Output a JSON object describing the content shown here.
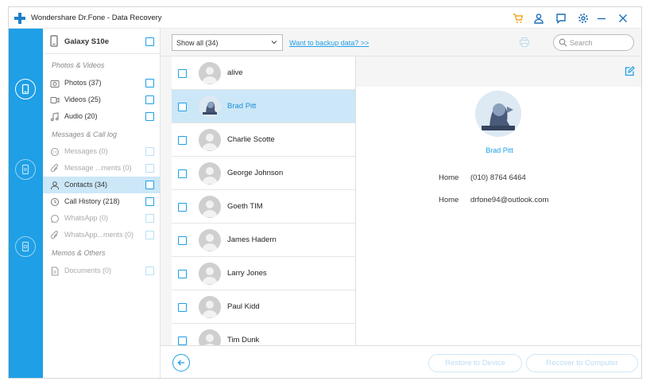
{
  "window": {
    "title": "Wondershare Dr.Fone - Data Recovery"
  },
  "titlebar_icons": [
    "cart-icon",
    "user-icon",
    "feedback-icon",
    "settings-icon",
    "minimize-icon",
    "close-icon"
  ],
  "colors": {
    "accent": "#1e9fe6",
    "cart": "#f5a623",
    "selected_row": "#cce7f7"
  },
  "device": {
    "name": "Galaxy S10e"
  },
  "categories": {
    "group1": "Photos & Videos",
    "photos": "Photos (37)",
    "videos": "Videos (25)",
    "audio": "Audio (20)",
    "group2": "Messages & Call log",
    "messages": "Messages (0)",
    "message_attachments": "Message ...ments (0)",
    "contacts": "Contacts (34)",
    "call_history": "Call History (218)",
    "whatsapp": "WhatsApp (0)",
    "whatsapp_attachments": "WhatsApp...ments (0)",
    "group3": "Memos & Others",
    "documents": "Documents (0)"
  },
  "toolbar": {
    "filter_value": "Show all (34)",
    "backup_link": "Want to backup data? >>",
    "search_placeholder": "Search"
  },
  "contacts": [
    {
      "name": "alive"
    },
    {
      "name": "Brad Pitt"
    },
    {
      "name": "Charlie Scotte"
    },
    {
      "name": "George Johnson"
    },
    {
      "name": "Goeth TIM"
    },
    {
      "name": "James Hadern"
    },
    {
      "name": "Larry Jones"
    },
    {
      "name": "Paul Kidd"
    },
    {
      "name": "Tim Dunk"
    }
  ],
  "detail": {
    "name": "Brad Pitt",
    "phone_type": "Home",
    "phone": "(010) 8764 6464",
    "email_type": "Home",
    "email": "drfone94@outlook.com"
  },
  "footer": {
    "restore_label": "Restore to Device",
    "recover_label": "Recover to Computer"
  }
}
